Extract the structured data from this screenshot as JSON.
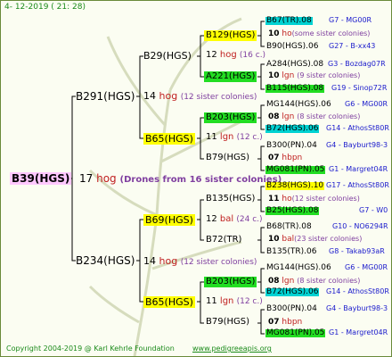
{
  "header": {
    "date": "4- 12-2019 ( 21: 28)"
  },
  "watermark": {
    "tree_text": "pedigreeapis.org"
  },
  "root": {
    "label": "B39(HGS)",
    "count": "17",
    "word": "hog",
    "note": "(Drones from 16 sister colonies)"
  },
  "gen1": [
    {
      "label": "B291(HGS)",
      "count": "14",
      "word": "hog",
      "note": "(12 sister colonies)"
    },
    {
      "label": "B234(HGS)",
      "count": "14",
      "word": "hog",
      "note": "(12 sister colonies)"
    }
  ],
  "gen2": [
    {
      "label": "B29(HGS)",
      "count": "12",
      "word": "hog",
      "note": "(16 c.)"
    },
    {
      "label": "B65(HGS)",
      "count": "11",
      "word": "lgn",
      "note": "(12 c.)"
    },
    {
      "label": "B69(HGS)",
      "count": "12",
      "word": "bal",
      "note": "(24 c.)"
    },
    {
      "label": "B65(HGS)",
      "count": "11",
      "word": "lgn",
      "note": "(12 c.)"
    }
  ],
  "gen3": [
    {
      "label": "B129(HGS)",
      "count": "10",
      "word": "ho",
      "note": "(some sister colonies)"
    },
    {
      "label": "A221(HGS)",
      "count": "10",
      "word": "lgn",
      "note": "(9 sister colonies)"
    },
    {
      "label": "B203(HGS)",
      "count": "08",
      "word": "lgn",
      "note": "(8 sister colonies)"
    },
    {
      "label": "B79(HGS)",
      "count": "07",
      "word": "hbpn",
      "note": ""
    },
    {
      "label": "B135(HGS)",
      "count": "11",
      "word": "ho",
      "note": "(12 sister colonies)"
    },
    {
      "label": "B72(TR)",
      "count": "10",
      "word": "bal",
      "note": "(23 sister colonies)"
    },
    {
      "label": "B203(HGS)",
      "count": "08",
      "word": "lgn",
      "note": "(8 sister colonies)"
    },
    {
      "label": "B79(HGS)",
      "count": "07",
      "word": "hbpn",
      "note": ""
    }
  ],
  "gen4": [
    {
      "left": "B67(TR).08",
      "right": "G7 - MG00R"
    },
    {
      "left": "B90(HGS).06",
      "right": "G27 - B-xx43"
    },
    {
      "left": "A284(HGS).08",
      "right": "G3 - Bozdag07R"
    },
    {
      "left": "B115(HGS).08",
      "right": "G19 - Sinop72R"
    },
    {
      "left": "MG144(HGS).06",
      "right": "G6 - MG00R"
    },
    {
      "left": "B72(HGS).06",
      "right": "G14 - AthosSt80R"
    },
    {
      "left": "B300(PN).04",
      "right": "G4 - Bayburt98-3"
    },
    {
      "left": "MG081(PN).05",
      "right": "G1 - Margret04R"
    },
    {
      "left": "B238(HGS).10",
      "right": "G17 - AthosSt80R"
    },
    {
      "left": "B25(HGS).08",
      "right": "G7 - W0"
    },
    {
      "left": "B68(TR).08",
      "right": "G10 - NO6294R"
    },
    {
      "left": "B135(TR).06",
      "right": "G8 - Takab93aR"
    },
    {
      "left": "MG144(HGS).06",
      "right": "G6 - MG00R"
    },
    {
      "left": "B72(HGS).06",
      "right": "G14 - AthosSt80R"
    },
    {
      "left": "B300(PN).04",
      "right": "G4 - Bayburt98-3"
    },
    {
      "left": "MG081(PN).05",
      "right": "G1 - Margret04R"
    }
  ],
  "footer": {
    "copyright": "Copyright 2004-2019 @ Karl Kehrle Foundation",
    "site": "www.pedigreeapis.org"
  },
  "colors": {
    "line": "#000000",
    "yellow": "#ffff00",
    "green": "#22dd22",
    "cyan": "#00d2d2",
    "accent_red": "#c02020",
    "note_purple": "#8040a0",
    "blue_text": "#1a1acc"
  }
}
